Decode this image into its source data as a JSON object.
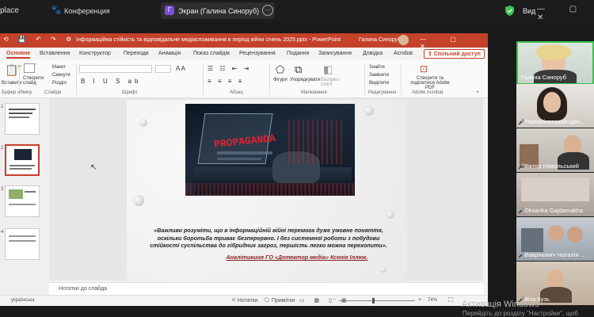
{
  "zoom_top": {
    "app_partial": "place",
    "conference_label": "Конференция",
    "screen_share_badge": "Г",
    "screen_share_label": "Экран (Галина Синоруб)",
    "more_label": "···",
    "view_label": "Вид",
    "window_controls": "— ▢ ✕"
  },
  "ppt": {
    "title_doc": "Інформаційна стійкість та відповідальне медіаспоживання в період війни січень 2025.pptx - PowerPoint",
    "title_user": "Галина Синоруб",
    "tabs": [
      "Основне",
      "Вставлення",
      "Конструктор",
      "Переходи",
      "Анімація",
      "Показ слайдів",
      "Рецензування",
      "Подання",
      "Записування",
      "Довідка",
      "Acrobat"
    ],
    "share_label": "Спільний доступ",
    "ribbon": {
      "paste": "Вставити",
      "new_slide": "Створити слайд",
      "layout": "Макет",
      "reset": "Скинути",
      "section": "Розділ",
      "shapes": "Фігури",
      "arrange": "Упорядкувати",
      "quick_styles": "Експрес-стилі",
      "find": "Знайти",
      "replace": "Замінити",
      "select": "Виділити",
      "adobe": "Створити та поділитися Adobe PDF",
      "groups": [
        "Буфер обміну",
        "Слайди",
        "Шрифт",
        "Абзац",
        "Малювання",
        "Редагування",
        "Adobe Acrobat"
      ]
    },
    "thumbnails": [
      "1",
      "2",
      "3",
      "4"
    ],
    "slide": {
      "image_text": "PROPAGANDA",
      "quote": "«Важливо розуміти, що в інформаційній війні перемога дуже умовне поняття, оскільки боротьба триває безперервно. І без системної роботи з побудови стійкості суспільства до гібридних загроз, першість легко можна перехопити».",
      "author": "Аналітикиня ГО «Детектор медіа» Ксенія Іллюк."
    },
    "notes_placeholder": "Нотатки до слайда",
    "status": {
      "language": "українська",
      "notes_btn": "Нотатки",
      "comments_btn": "Примітки",
      "zoom": "74%"
    }
  },
  "participants": [
    {
      "name": "Галина Синоруб",
      "speaking": true,
      "muted": false
    },
    {
      "name": "Тернопільський Цен...",
      "speaking": false,
      "muted": true
    },
    {
      "name": "Віктор Навольський",
      "speaking": false,
      "muted": true
    },
    {
      "name": "Oksanka Gajdamakha",
      "speaking": false,
      "muted": true
    },
    {
      "name": "Ваврінович Наталія ...",
      "speaking": false,
      "muted": true
    },
    {
      "name": "Віта Кузь",
      "speaking": false,
      "muted": true
    }
  ],
  "windows_watermark": {
    "line1": "Активація Windows",
    "line2": "Перейдіть до розділу \"Настройки\", щоб"
  }
}
